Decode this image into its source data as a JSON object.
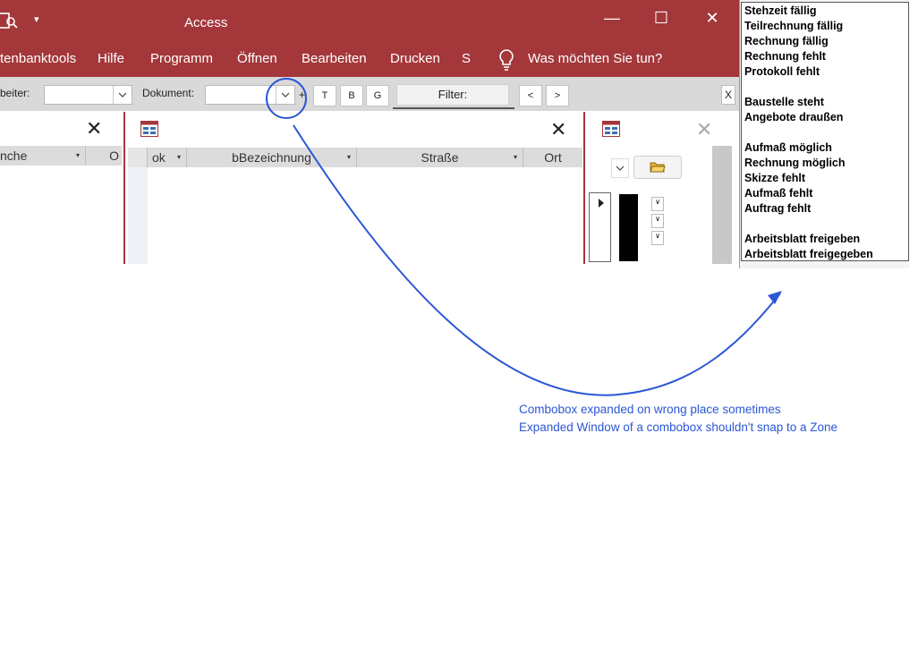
{
  "app": {
    "title": "Access"
  },
  "ribbon": {
    "tabs": [
      "tenbanktools",
      "Hilfe",
      "Programm",
      "Öffnen",
      "Bearbeiten",
      "Drucken",
      "S"
    ],
    "tell_me": "Was möchten Sie tun?"
  },
  "toolbar": {
    "bearbeiter_label": "beiter:",
    "bearbeiter_value": "",
    "dokument_label": "Dokument:",
    "dokument_value": "",
    "plus": "+",
    "t_label": "T",
    "b_label": "B",
    "g_label": "G",
    "filter_label": "Filter:",
    "prev_label": "<",
    "next_label": ">",
    "close_label": "X"
  },
  "left_panel": {
    "col1": "nche",
    "col2": "O"
  },
  "mid_panel": {
    "columns": [
      "ok",
      "bBezeichnung",
      "Straße",
      "Ort"
    ]
  },
  "popup_list": {
    "items": [
      "Stehzeit fällig",
      "Teilrechnung fällig",
      "Rechnung fällig",
      "Rechnung fehlt",
      "Protokoll fehlt",
      "",
      "Baustelle steht",
      "Angebote draußen",
      "",
      "Aufmaß möglich",
      "Rechnung möglich",
      "Skizze fehlt",
      "Aufmaß fehlt",
      "Auftrag fehlt",
      "",
      "Arbeitsblatt freigeben",
      "Arbeitsblatt freigegeben"
    ]
  },
  "annotation": {
    "line1": "Combobox expanded on wrong place  sometimes",
    "line2": "Expanded Window of a combobox shouldn't snap to a Zone"
  },
  "colors": {
    "accent": "#a4373a",
    "annotation": "#2b57d6"
  }
}
